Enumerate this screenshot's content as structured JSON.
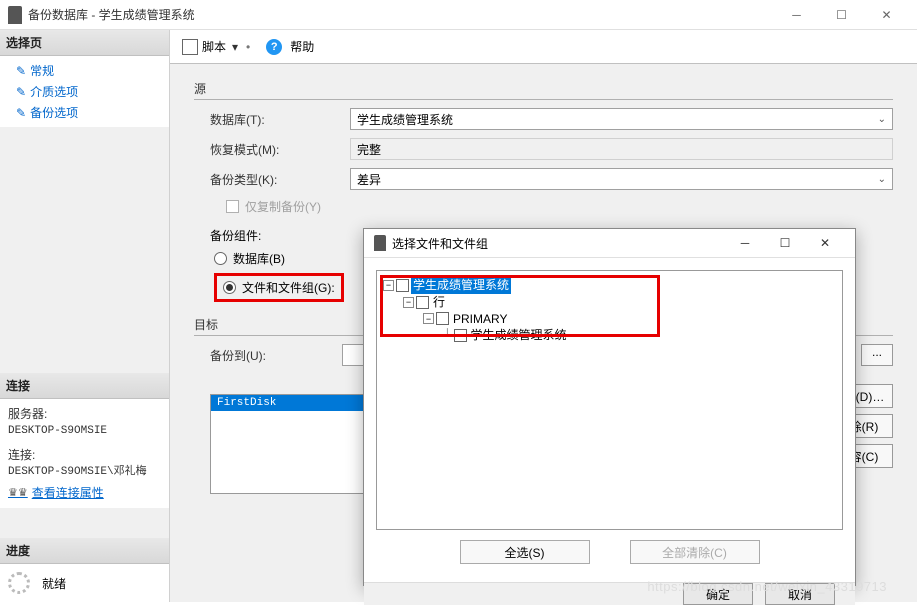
{
  "window": {
    "title": "备份数据库 - 学生成绩管理系统"
  },
  "sidebar": {
    "select_page": "选择页",
    "nav": {
      "general": "常规",
      "media": "介质选项",
      "backup_opts": "备份选项"
    },
    "connection_header": "连接",
    "server_label": "服务器:",
    "server_value": "DESKTOP-S9OMSIE",
    "conn_label": "连接:",
    "conn_value": "DESKTOP-S9OMSIE\\邓礼梅",
    "view_conn_props": "查看连接属性",
    "progress_header": "进度",
    "progress_status": "就绪"
  },
  "toolbar": {
    "script": "脚本",
    "help": "帮助"
  },
  "form": {
    "source_header": "源",
    "database_label": "数据库(T):",
    "database_value": "学生成绩管理系统",
    "recovery_label": "恢复模式(M):",
    "recovery_value": "完整",
    "backup_type_label": "备份类型(K):",
    "backup_type_value": "差异",
    "copy_only": "仅复制备份(Y)",
    "component_header": "备份组件:",
    "radio_database": "数据库(B)",
    "radio_files": "文件和文件组(G):",
    "dest_header": "目标",
    "backup_to_label": "备份到(U):",
    "backup_to_value": "",
    "list_item": "FirstDisk",
    "browse": "...",
    "add_btn": "添加(D)…",
    "remove_btn": "删除(R)",
    "content_btn": "内容(C)"
  },
  "dialog": {
    "title": "选择文件和文件组",
    "tree": {
      "root": "学生成绩管理系统",
      "row": "行",
      "primary": "PRIMARY",
      "leaf": "学生成绩管理系统"
    },
    "select_all": "全选(S)",
    "clear_all": "全部清除(C)",
    "ok": "确定",
    "cancel": "取消"
  },
  "watermark": "https://blog.csdn.net/weixin_43319713"
}
